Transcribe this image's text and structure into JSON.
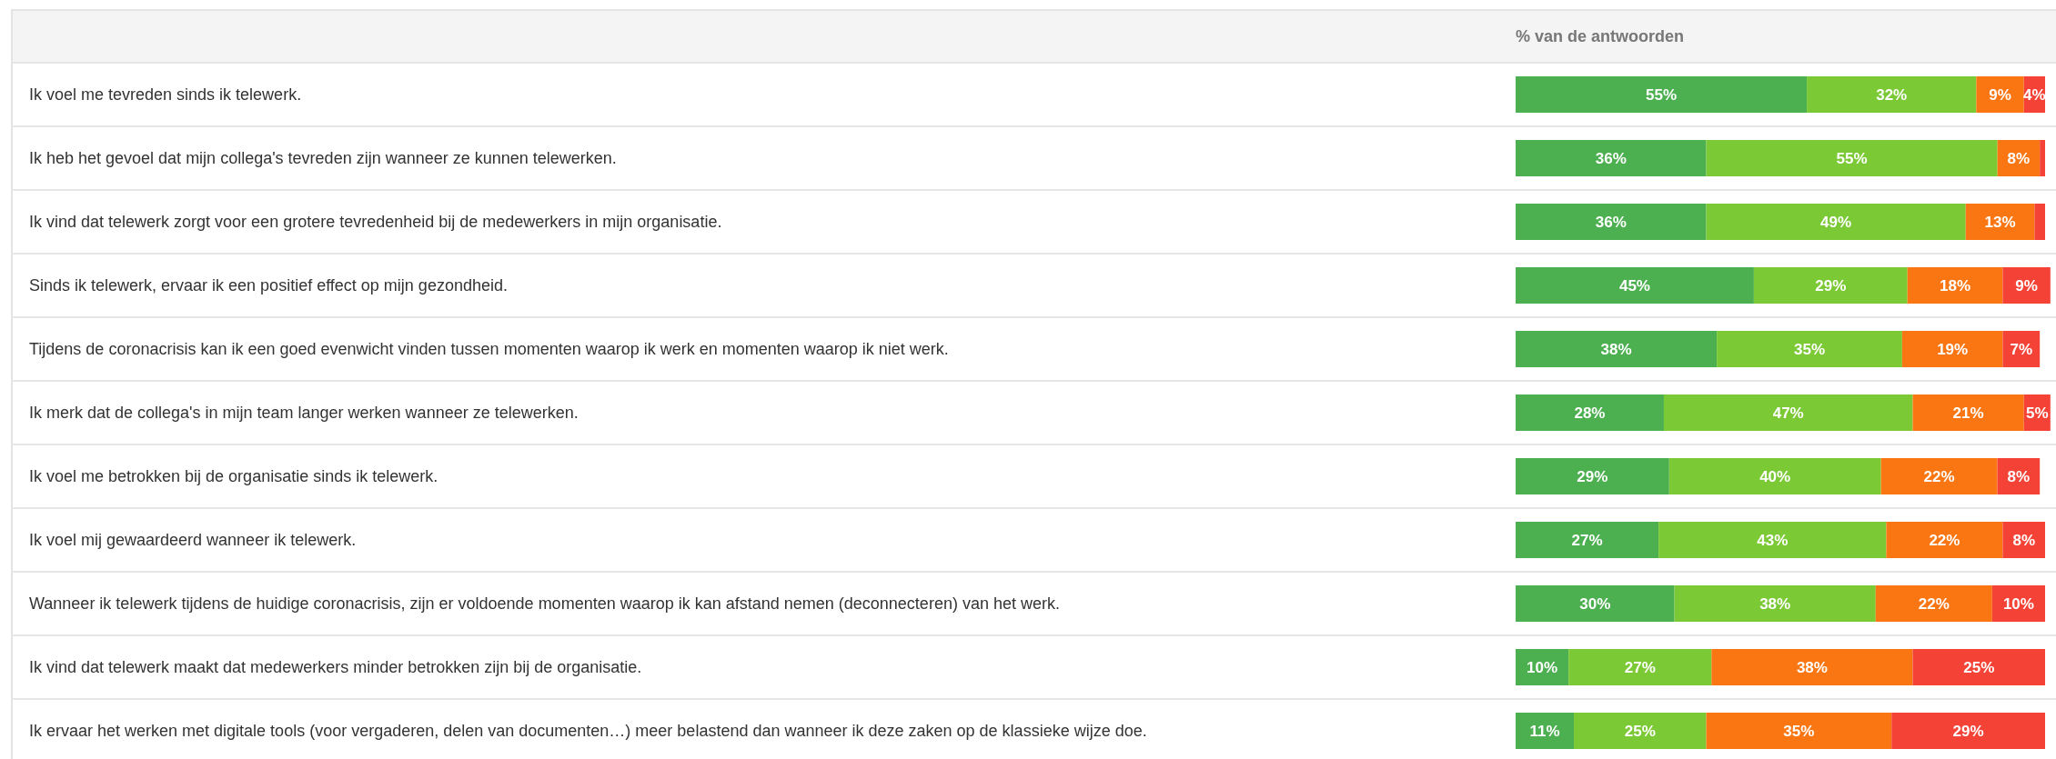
{
  "table": {
    "header": "% van de antwoorden",
    "rows": [
      {
        "statement": "Ik voel me tevreden sinds ik telewerk.",
        "chart_data": {
          "type": "bar",
          "orientation": "horizontal",
          "stacked": true,
          "categories": [
            null
          ],
          "series": [
            {
              "color": "#4caf50",
              "values": [
                55
              ],
              "value_labels": [
                "55%"
              ]
            },
            {
              "color": "#7bc934",
              "values": [
                32
              ],
              "value_labels": [
                "32%"
              ]
            },
            {
              "color": "#f97612",
              "values": [
                9
              ],
              "value_labels": [
                "9%"
              ]
            },
            {
              "color": "#f44336",
              "values": [
                4
              ],
              "value_labels": [
                "4%"
              ]
            }
          ]
        }
      },
      {
        "statement": "Ik heb het gevoel dat mijn collega's tevreden zijn wanneer ze kunnen telewerken.",
        "chart_data": {
          "type": "bar",
          "orientation": "horizontal",
          "stacked": true,
          "categories": [
            null
          ],
          "series": [
            {
              "color": "#4caf50",
              "values": [
                36
              ],
              "value_labels": [
                "36%"
              ]
            },
            {
              "color": "#7bc934",
              "values": [
                55
              ],
              "value_labels": [
                "55%"
              ]
            },
            {
              "color": "#f97612",
              "values": [
                8
              ],
              "value_labels": [
                "8%"
              ]
            },
            {
              "color": "#f44336",
              "values": [
                1
              ],
              "value_labels": [
                null
              ]
            }
          ]
        }
      },
      {
        "statement": "Ik vind dat telewerk zorgt voor een grotere tevredenheid bij de medewerkers in mijn organisatie.",
        "chart_data": {
          "type": "bar",
          "orientation": "horizontal",
          "stacked": true,
          "categories": [
            null
          ],
          "series": [
            {
              "color": "#4caf50",
              "values": [
                36
              ],
              "value_labels": [
                "36%"
              ]
            },
            {
              "color": "#7bc934",
              "values": [
                49
              ],
              "value_labels": [
                "49%"
              ]
            },
            {
              "color": "#f97612",
              "values": [
                13
              ],
              "value_labels": [
                "13%"
              ]
            },
            {
              "color": "#f44336",
              "values": [
                2
              ],
              "value_labels": [
                null
              ]
            }
          ]
        }
      },
      {
        "statement": "Sinds ik telewerk, ervaar ik een positief effect op mijn gezondheid.",
        "chart_data": {
          "type": "bar",
          "orientation": "horizontal",
          "stacked": true,
          "categories": [
            null
          ],
          "series": [
            {
              "color": "#4caf50",
              "values": [
                45
              ],
              "value_labels": [
                "45%"
              ]
            },
            {
              "color": "#7bc934",
              "values": [
                29
              ],
              "value_labels": [
                "29%"
              ]
            },
            {
              "color": "#f97612",
              "values": [
                18
              ],
              "value_labels": [
                "18%"
              ]
            },
            {
              "color": "#f44336",
              "values": [
                9
              ],
              "value_labels": [
                "9%"
              ]
            }
          ]
        }
      },
      {
        "statement": "Tijdens de coronacrisis kan ik een goed evenwicht vinden tussen momenten waarop ik werk en momenten waarop ik niet werk.",
        "chart_data": {
          "type": "bar",
          "orientation": "horizontal",
          "stacked": true,
          "categories": [
            null
          ],
          "series": [
            {
              "color": "#4caf50",
              "values": [
                38
              ],
              "value_labels": [
                "38%"
              ]
            },
            {
              "color": "#7bc934",
              "values": [
                35
              ],
              "value_labels": [
                "35%"
              ]
            },
            {
              "color": "#f97612",
              "values": [
                19
              ],
              "value_labels": [
                "19%"
              ]
            },
            {
              "color": "#f44336",
              "values": [
                7
              ],
              "value_labels": [
                "7%"
              ]
            }
          ]
        }
      },
      {
        "statement": "Ik merk dat de collega's in mijn team langer werken wanneer ze telewerken.",
        "chart_data": {
          "type": "bar",
          "orientation": "horizontal",
          "stacked": true,
          "categories": [
            null
          ],
          "series": [
            {
              "color": "#4caf50",
              "values": [
                28
              ],
              "value_labels": [
                "28%"
              ]
            },
            {
              "color": "#7bc934",
              "values": [
                47
              ],
              "value_labels": [
                "47%"
              ]
            },
            {
              "color": "#f97612",
              "values": [
                21
              ],
              "value_labels": [
                "21%"
              ]
            },
            {
              "color": "#f44336",
              "values": [
                5
              ],
              "value_labels": [
                "5%"
              ]
            }
          ]
        }
      },
      {
        "statement": "Ik voel me betrokken bij de organisatie sinds ik telewerk.",
        "chart_data": {
          "type": "bar",
          "orientation": "horizontal",
          "stacked": true,
          "categories": [
            null
          ],
          "series": [
            {
              "color": "#4caf50",
              "values": [
                29
              ],
              "value_labels": [
                "29%"
              ]
            },
            {
              "color": "#7bc934",
              "values": [
                40
              ],
              "value_labels": [
                "40%"
              ]
            },
            {
              "color": "#f97612",
              "values": [
                22
              ],
              "value_labels": [
                "22%"
              ]
            },
            {
              "color": "#f44336",
              "values": [
                8
              ],
              "value_labels": [
                "8%"
              ]
            }
          ]
        }
      },
      {
        "statement": "Ik voel mij gewaardeerd wanneer ik telewerk.",
        "chart_data": {
          "type": "bar",
          "orientation": "horizontal",
          "stacked": true,
          "categories": [
            null
          ],
          "series": [
            {
              "color": "#4caf50",
              "values": [
                27
              ],
              "value_labels": [
                "27%"
              ]
            },
            {
              "color": "#7bc934",
              "values": [
                43
              ],
              "value_labels": [
                "43%"
              ]
            },
            {
              "color": "#f97612",
              "values": [
                22
              ],
              "value_labels": [
                "22%"
              ]
            },
            {
              "color": "#f44336",
              "values": [
                8
              ],
              "value_labels": [
                "8%"
              ]
            }
          ]
        }
      },
      {
        "statement": "Wanneer ik telewerk tijdens de huidige coronacrisis, zijn er voldoende momenten waarop ik kan afstand nemen (deconnecteren) van het werk.",
        "chart_data": {
          "type": "bar",
          "orientation": "horizontal",
          "stacked": true,
          "categories": [
            null
          ],
          "series": [
            {
              "color": "#4caf50",
              "values": [
                30
              ],
              "value_labels": [
                "30%"
              ]
            },
            {
              "color": "#7bc934",
              "values": [
                38
              ],
              "value_labels": [
                "38%"
              ]
            },
            {
              "color": "#f97612",
              "values": [
                22
              ],
              "value_labels": [
                "22%"
              ]
            },
            {
              "color": "#f44336",
              "values": [
                10
              ],
              "value_labels": [
                "10%"
              ]
            }
          ]
        }
      },
      {
        "statement": "Ik vind dat telewerk maakt dat medewerkers minder betrokken zijn bij de organisatie.",
        "chart_data": {
          "type": "bar",
          "orientation": "horizontal",
          "stacked": true,
          "categories": [
            null
          ],
          "series": [
            {
              "color": "#4caf50",
              "values": [
                10
              ],
              "value_labels": [
                "10%"
              ]
            },
            {
              "color": "#7bc934",
              "values": [
                27
              ],
              "value_labels": [
                "27%"
              ]
            },
            {
              "color": "#f97612",
              "values": [
                38
              ],
              "value_labels": [
                "38%"
              ]
            },
            {
              "color": "#f44336",
              "values": [
                25
              ],
              "value_labels": [
                "25%"
              ]
            }
          ]
        }
      },
      {
        "statement": "Ik ervaar het werken met digitale tools (voor vergaderen, delen van documenten…) meer belastend dan wanneer ik deze zaken op de klassieke wijze doe.",
        "chart_data": {
          "type": "bar",
          "orientation": "horizontal",
          "stacked": true,
          "categories": [
            null
          ],
          "series": [
            {
              "color": "#4caf50",
              "values": [
                11
              ],
              "value_labels": [
                "11%"
              ]
            },
            {
              "color": "#7bc934",
              "values": [
                25
              ],
              "value_labels": [
                "25%"
              ]
            },
            {
              "color": "#f97612",
              "values": [
                35
              ],
              "value_labels": [
                "35%"
              ]
            },
            {
              "color": "#f44336",
              "values": [
                29
              ],
              "value_labels": [
                "29%"
              ]
            }
          ]
        }
      }
    ]
  }
}
